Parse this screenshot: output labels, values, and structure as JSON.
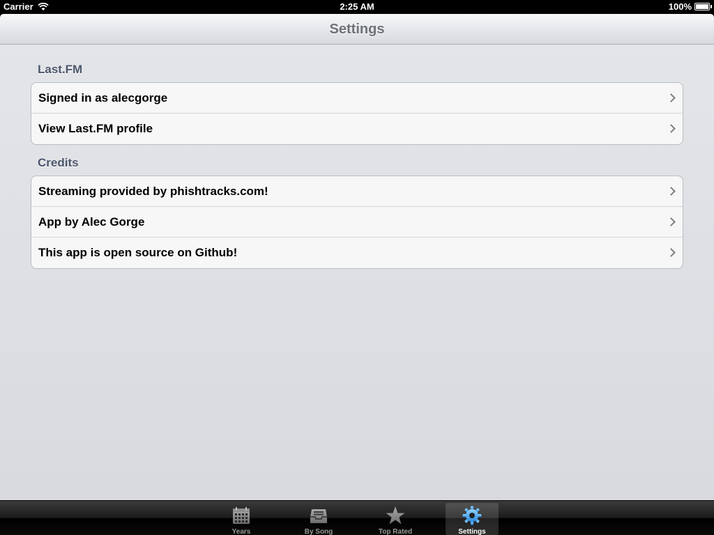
{
  "status_bar": {
    "carrier": "Carrier",
    "time": "2:25 AM",
    "battery": "100%"
  },
  "nav": {
    "title": "Settings"
  },
  "sections": [
    {
      "header": "Last.FM",
      "rows": [
        {
          "label": "Signed in as alecgorge"
        },
        {
          "label": "View Last.FM profile"
        }
      ]
    },
    {
      "header": "Credits",
      "rows": [
        {
          "label": "Streaming provided by phishtracks.com!"
        },
        {
          "label": "App by Alec Gorge"
        },
        {
          "label": "This app is open source on Github!"
        }
      ]
    }
  ],
  "tab_bar": {
    "tabs": [
      {
        "label": "Years",
        "icon": "calendar-icon",
        "selected": false
      },
      {
        "label": "By Song",
        "icon": "inbox-tray-icon",
        "selected": false
      },
      {
        "label": "Top Rated",
        "icon": "star-icon",
        "selected": false
      },
      {
        "label": "Settings",
        "icon": "gear-icon",
        "selected": true
      }
    ],
    "selected_color": "#5fb0f0"
  }
}
